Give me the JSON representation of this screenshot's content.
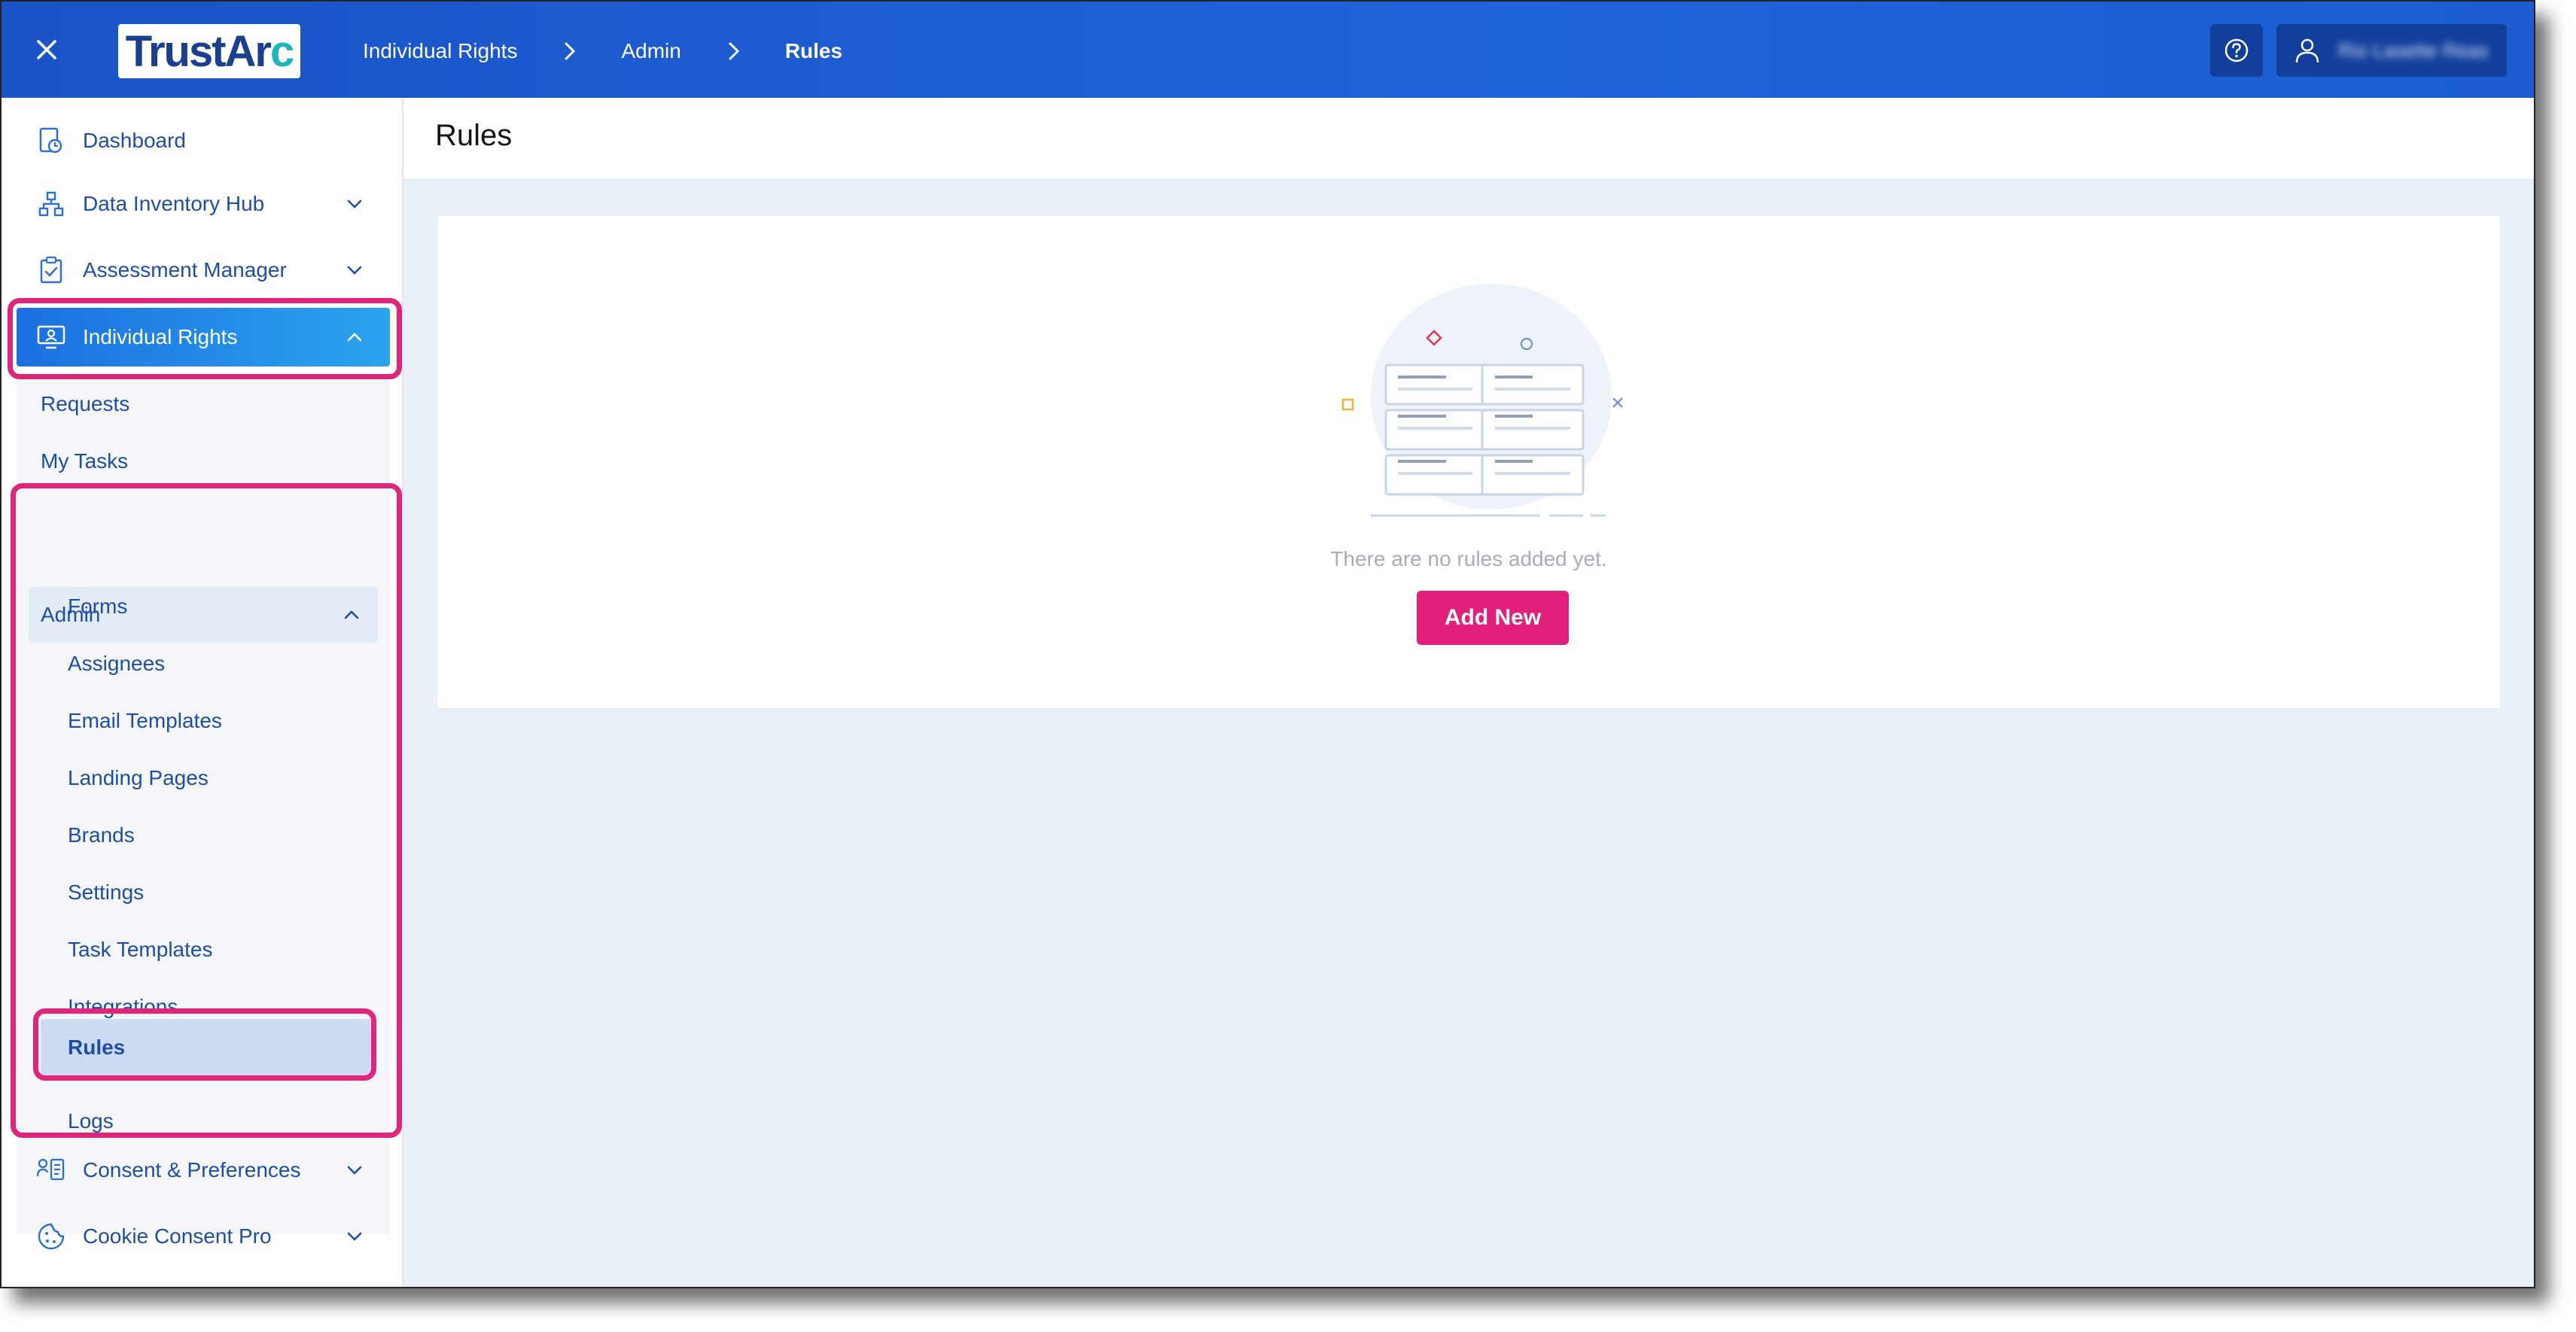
{
  "topbar": {
    "logo": "TrustArc",
    "breadcrumbs": [
      "Individual Rights",
      "Admin",
      "Rules"
    ],
    "user_name": "Rio Lasette Reas"
  },
  "sidebar": {
    "items": [
      {
        "label": "Dashboard",
        "icon": "dashboard-icon"
      },
      {
        "label": "Data Inventory Hub",
        "icon": "hierarchy-icon"
      },
      {
        "label": "Assessment Manager",
        "icon": "clipboard-check-icon"
      },
      {
        "label": "Individual Rights",
        "icon": "person-screen-icon"
      },
      {
        "label": "Consent & Preferences",
        "icon": "consent-icon"
      },
      {
        "label": "Cookie Consent Pro",
        "icon": "cookie-icon"
      }
    ],
    "individual_rights": {
      "requests": "Requests",
      "my_tasks": "My Tasks",
      "admin": "Admin",
      "admin_items": [
        "Forms",
        "Assignees",
        "Email Templates",
        "Landing Pages",
        "Brands",
        "Settings",
        "Task Templates",
        "Integrations",
        "Rules",
        "Logs"
      ]
    }
  },
  "main": {
    "title": "Rules",
    "empty_message": "There are no rules added yet.",
    "add_button": "Add New"
  },
  "colors": {
    "topbar": "#1c5cd0",
    "accent_pink": "#e21f7a",
    "highlight_border": "#e0267a",
    "nav_text": "#1e4ea8"
  }
}
